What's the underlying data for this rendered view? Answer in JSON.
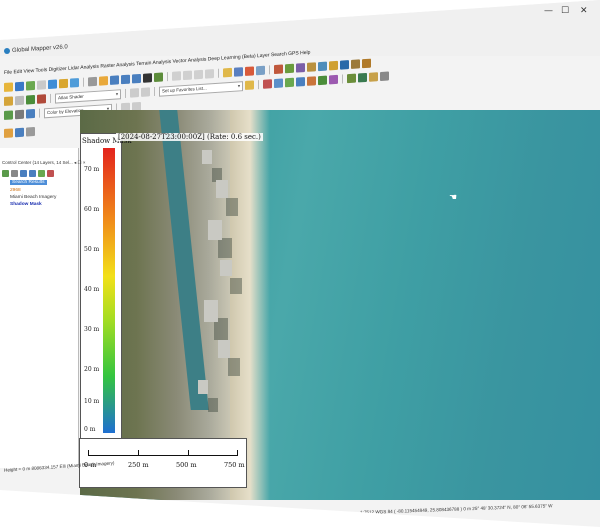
{
  "window": {
    "title": "Global Mapper v26.0",
    "controls": {
      "minimize": "—",
      "maximize": "☐",
      "close": "✕"
    }
  },
  "menu": [
    "File",
    "Edit",
    "View",
    "Tools",
    "Digitizer",
    "Lidar Analysis",
    "Raster Analysis",
    "Terrain Analysis",
    "Vector Analysis",
    "Deep Learning (Beta)",
    "Layer",
    "Search",
    "GPS",
    "Help"
  ],
  "toolbar": {
    "shader_combo": "Atlas Shader",
    "favorites_combo": "Set up Favorites List...",
    "color_combo": "Color by Elevation"
  },
  "control_center": {
    "title": "Control Center (14 Layers, 14 Sel... ◂ ☐ ×",
    "layers": [
      {
        "label": "Search Results",
        "selected": true
      },
      {
        "label": "2968",
        "color": "#d07010"
      },
      {
        "label": "Miami Beach Imagery",
        "color": "#333333"
      },
      {
        "label": "Shadow Mask",
        "color": "#1b2fb0",
        "bold": true
      }
    ]
  },
  "legend": {
    "title": "Shadow Mask",
    "timestamp": "[2024-08-27T23:00:00Z] (Rate: 0.6 sec.)",
    "ticks": [
      "70 m",
      "60 m",
      "50 m",
      "40 m",
      "30 m",
      "20 m",
      "10 m",
      "0 m"
    ]
  },
  "scalebar": {
    "labels": [
      "0 m",
      "250 m",
      "500 m",
      "750 m"
    ]
  },
  "status": {
    "left": "Height = 0 m  8086334.157 Elli (Miami Beach Imagery)",
    "right": "1:7512  WGS 84 ( -80.115454849, 25.808436788 )  0 m  25° 48' 30.3724\" N, 80° 06' 55.6375\" W"
  },
  "colors": {
    "ramp_top": "#e3241d",
    "ramp_mid": "#f2e019",
    "ramp_low": "#34c53f",
    "ramp_bottom": "#1f6fd1",
    "ocean": "#3a9da0"
  }
}
